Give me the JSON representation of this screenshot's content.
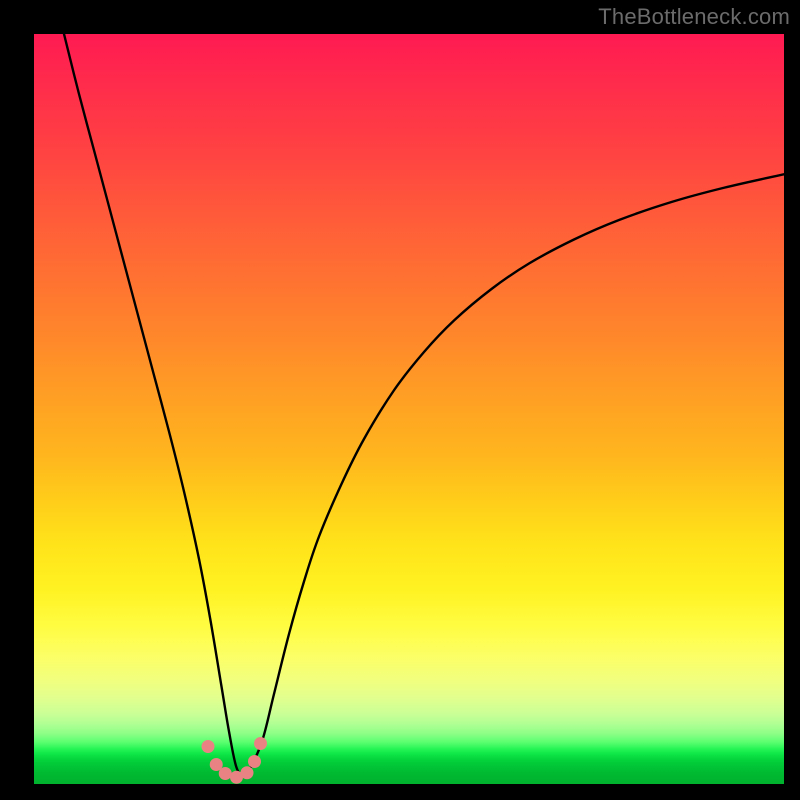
{
  "watermark": "TheBottleneck.com",
  "colors": {
    "frame": "#000000",
    "curve_stroke": "#000000",
    "marker_fill": "#e98383",
    "marker_stroke": "#c06060",
    "gradient_top": "#ff1a52",
    "gradient_mid": "#fff222",
    "gradient_bottom": "#00b22e"
  },
  "chart_data": {
    "type": "line",
    "title": "",
    "xlabel": "",
    "ylabel": "",
    "x_range": [
      0,
      100
    ],
    "y_range": [
      0,
      100
    ],
    "description": "Bottleneck-percentage style curve: steep V/U-shaped dip to ~0% near x≈27, rising asymptotically toward the right. Heatmap-style vertical gradient background red→yellow→green.",
    "series": [
      {
        "name": "bottleneck-curve",
        "x": [
          4,
          6,
          8,
          10,
          12,
          14,
          16,
          18,
          20,
          22,
          23.5,
          25,
          26,
          27,
          28,
          29,
          30.5,
          32,
          34,
          36,
          38,
          41,
          44,
          48,
          52,
          56,
          61,
          66,
          72,
          78,
          85,
          92,
          100
        ],
        "y": [
          100,
          92,
          84.5,
          77,
          69.5,
          62,
          54.5,
          47,
          39,
          30,
          22,
          13,
          7,
          2.2,
          1.2,
          2.4,
          6,
          12,
          20,
          27,
          33,
          40,
          46,
          52.5,
          57.6,
          61.8,
          66,
          69.4,
          72.6,
          75.2,
          77.6,
          79.5,
          81.3
        ]
      }
    ],
    "markers": {
      "name": "highlighted-points-near-minimum",
      "x": [
        23.2,
        24.3,
        25.5,
        27.0,
        28.4,
        29.4,
        30.2
      ],
      "y": [
        5.0,
        2.6,
        1.4,
        0.9,
        1.5,
        3.0,
        5.4
      ]
    }
  }
}
